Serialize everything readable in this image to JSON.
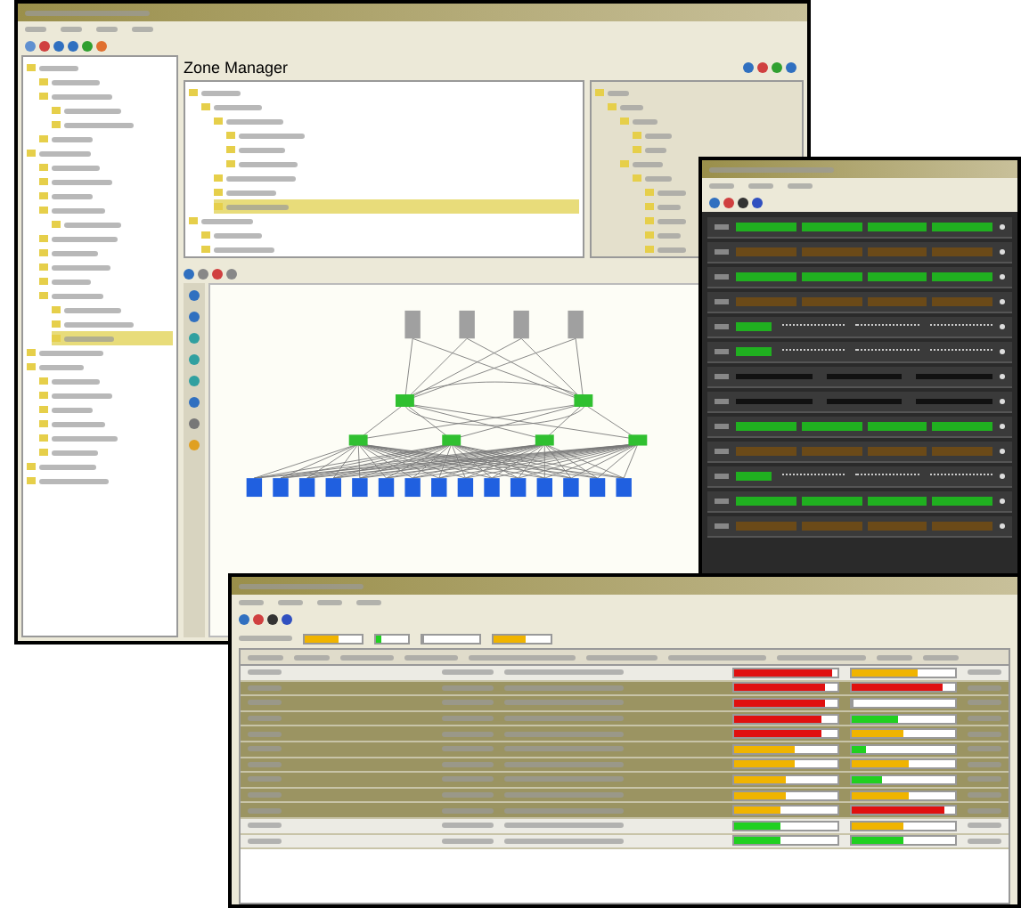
{
  "main_window": {
    "panel_title": "Zone Manager",
    "nav_tree": [
      {
        "selected": false,
        "children": [
          {
            "selected": false
          },
          {
            "selected": false,
            "children": [
              {
                "selected": false
              },
              {
                "selected": false
              }
            ]
          },
          {
            "selected": false
          }
        ]
      },
      {
        "selected": false,
        "children": [
          {
            "selected": false
          },
          {
            "selected": false
          },
          {
            "selected": false
          },
          {
            "selected": false,
            "children": [
              {
                "selected": false
              }
            ]
          },
          {
            "selected": false
          },
          {
            "selected": false
          },
          {
            "selected": false
          },
          {
            "selected": false
          },
          {
            "selected": false,
            "children": [
              {
                "selected": false
              },
              {
                "selected": false
              },
              {
                "selected": true
              }
            ]
          }
        ]
      },
      {
        "selected": false
      },
      {
        "selected": false,
        "children": [
          {
            "selected": false
          },
          {
            "selected": false
          },
          {
            "selected": false
          },
          {
            "selected": false
          },
          {
            "selected": false
          },
          {
            "selected": false
          }
        ]
      },
      {
        "selected": false
      },
      {
        "selected": false
      }
    ],
    "zone_tree": [
      {
        "selected": false,
        "children": [
          {
            "selected": false,
            "children": [
              {
                "selected": false,
                "children": [
                  {
                    "selected": false
                  },
                  {
                    "selected": false
                  },
                  {
                    "selected": false
                  }
                ]
              },
              {
                "selected": false
              },
              {
                "selected": false
              },
              {
                "selected": true
              }
            ]
          }
        ]
      },
      {
        "selected": false,
        "children": [
          {
            "selected": false
          },
          {
            "selected": false
          }
        ]
      }
    ],
    "member_tree": [
      {
        "selected": false,
        "children": [
          {
            "selected": false,
            "children": [
              {
                "selected": false,
                "children": [
                  {
                    "selected": false
                  },
                  {
                    "selected": false
                  }
                ]
              },
              {
                "selected": false,
                "children": [
                  {
                    "selected": false,
                    "children": [
                      {
                        "selected": false
                      },
                      {
                        "selected": false
                      },
                      {
                        "selected": false
                      },
                      {
                        "selected": false
                      },
                      {
                        "selected": false
                      }
                    ]
                  }
                ]
              }
            ]
          }
        ]
      }
    ]
  },
  "rack_window": {
    "slots": [
      {
        "kind": "green"
      },
      {
        "kind": "amber"
      },
      {
        "kind": "green"
      },
      {
        "kind": "amber"
      },
      {
        "kind": "dots"
      },
      {
        "kind": "dots"
      },
      {
        "kind": "dark"
      },
      {
        "kind": "dark"
      },
      {
        "kind": "green"
      },
      {
        "kind": "amber"
      },
      {
        "kind": "dots"
      },
      {
        "kind": "green"
      },
      {
        "kind": "amber"
      }
    ]
  },
  "performance_window": {
    "filters": [
      {
        "level": 0.6,
        "color": "#f0b400"
      },
      {
        "level": 0.15,
        "color": "#20d020"
      },
      {
        "level": 0.0
      },
      {
        "level": 0.55,
        "color": "#f0b400"
      }
    ],
    "rows": [
      {
        "highlighted": false,
        "meters": [
          {
            "level": 0.95,
            "color": "#e01010"
          },
          {
            "level": 0.65,
            "color": "#f0b400"
          }
        ]
      },
      {
        "highlighted": true,
        "meters": [
          {
            "level": 0.88,
            "color": "#e01010"
          },
          {
            "level": 0.88,
            "color": "#e01010"
          }
        ]
      },
      {
        "highlighted": true,
        "meters": [
          {
            "level": 0.88,
            "color": "#e01010"
          },
          {
            "level": 0.0
          }
        ]
      },
      {
        "highlighted": true,
        "meters": [
          {
            "level": 0.85,
            "color": "#e01010"
          },
          {
            "level": 0.45,
            "color": "#20d020"
          }
        ]
      },
      {
        "highlighted": true,
        "meters": [
          {
            "level": 0.85,
            "color": "#e01010"
          },
          {
            "level": 0.5,
            "color": "#f0b400"
          }
        ]
      },
      {
        "highlighted": true,
        "meters": [
          {
            "level": 0.6,
            "color": "#f0b400"
          },
          {
            "level": 0.15,
            "color": "#20d020"
          }
        ]
      },
      {
        "highlighted": true,
        "meters": [
          {
            "level": 0.6,
            "color": "#f0b400"
          },
          {
            "level": 0.55,
            "color": "#f0b400"
          }
        ]
      },
      {
        "highlighted": true,
        "meters": [
          {
            "level": 0.5,
            "color": "#f0b400"
          },
          {
            "level": 0.3,
            "color": "#20d020"
          }
        ]
      },
      {
        "highlighted": true,
        "meters": [
          {
            "level": 0.5,
            "color": "#f0b400"
          },
          {
            "level": 0.55,
            "color": "#f0b400"
          }
        ]
      },
      {
        "highlighted": true,
        "meters": [
          {
            "level": 0.45,
            "color": "#f0b400"
          },
          {
            "level": 0.9,
            "color": "#e01010"
          }
        ]
      },
      {
        "highlighted": false,
        "meters": [
          {
            "level": 0.45,
            "color": "#20d020"
          },
          {
            "level": 0.5,
            "color": "#f0b400"
          }
        ]
      },
      {
        "highlighted": false,
        "meters": [
          {
            "level": 0.45,
            "color": "#20d020"
          },
          {
            "level": 0.5,
            "color": "#20d020"
          }
        ]
      }
    ]
  }
}
